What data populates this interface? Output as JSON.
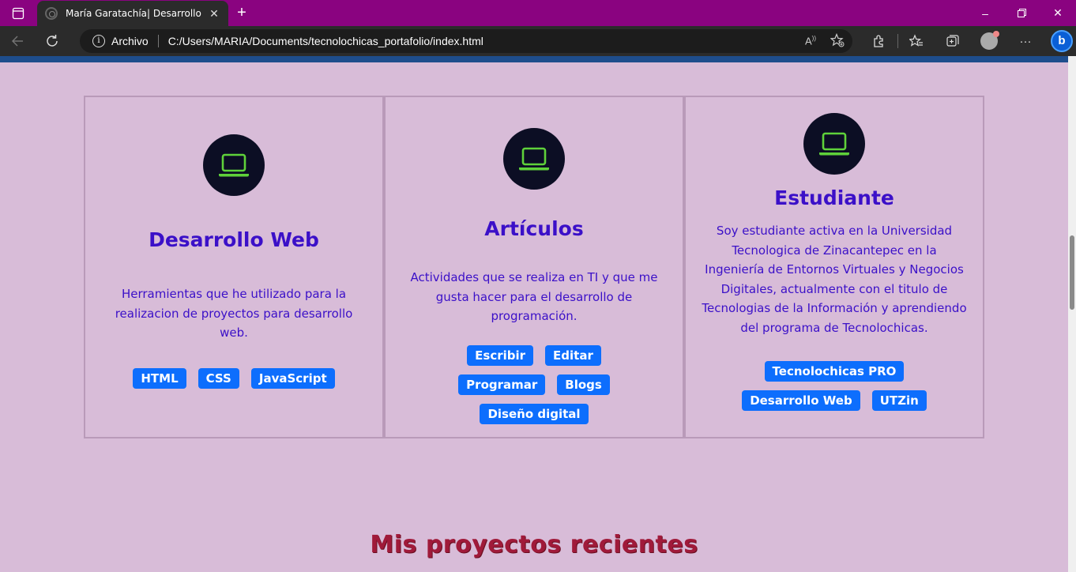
{
  "browser": {
    "tab_title": "María Garatachía| Desarrollo Web",
    "tab_close": "✕",
    "url_label": "Archivo",
    "url": "C:/Users/MARIA/Documents/tecnolochicas_portafolio/index.html"
  },
  "cards": [
    {
      "icon": "laptop-icon",
      "title": "Desarrollo Web",
      "text": "Herramientas que he utilizado para la realizacion de proyectos para desarrollo web.",
      "tags": [
        "HTML",
        "CSS",
        "JavaScript"
      ]
    },
    {
      "icon": "laptop-icon",
      "title": "Artículos",
      "text": "Actividades que se realiza en TI y que me gusta hacer para el desarrollo de programación.",
      "tags": [
        "Escribir",
        "Editar",
        "Programar",
        "Blogs",
        "Diseño digital"
      ]
    },
    {
      "icon": "laptop-icon",
      "title": "Estudiante",
      "text": "Soy estudiante activa en la Universidad Tecnologica de Zinacantepec en la Ingeniería de Entornos Virtuales y Negocios Digitales, actualmente con el titulo de Tecnologias de la Información y aprendiendo del programa de Tecnolochicas.",
      "tags": [
        "Tecnolochicas PRO",
        "Desarrollo Web",
        "UTZin"
      ]
    }
  ],
  "section_title": "Mis proyectos recientes",
  "colors": {
    "page_bg": "#d8bcd8",
    "card_text": "#3b10c8",
    "tag_bg": "#0d6efd",
    "icon_circle": "#0c0e24",
    "icon_green": "#5fd13a",
    "section_title": "#a01a3a"
  }
}
